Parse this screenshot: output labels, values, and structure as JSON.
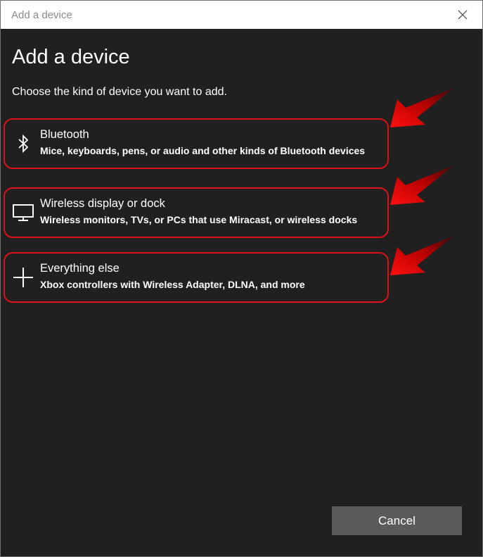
{
  "window": {
    "title": "Add a device",
    "close_icon": "close-icon"
  },
  "main": {
    "heading": "Add a device",
    "subheading": "Choose the kind of device you want to add."
  },
  "options": [
    {
      "icon": "bluetooth-icon",
      "title": "Bluetooth",
      "description": "Mice, keyboards, pens, or audio and other kinds of Bluetooth devices"
    },
    {
      "icon": "monitor-icon",
      "title": "Wireless display or dock",
      "description": "Wireless monitors, TVs, or PCs that use Miracast, or wireless docks"
    },
    {
      "icon": "plus-icon",
      "title": "Everything else",
      "description": "Xbox controllers with Wireless Adapter, DLNA, and more"
    }
  ],
  "footer": {
    "cancel_label": "Cancel"
  },
  "colors": {
    "background": "#202020",
    "highlight": "#e0101a",
    "button": "#5a5a5a"
  }
}
